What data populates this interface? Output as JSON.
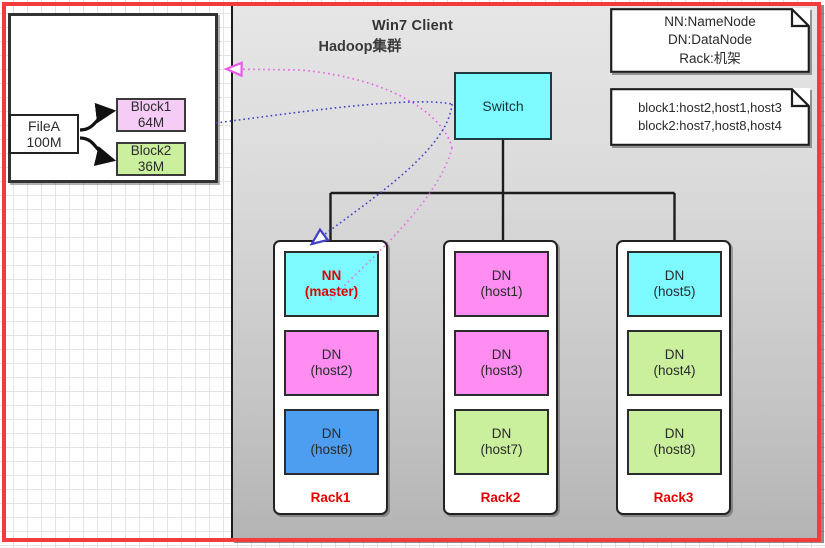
{
  "frame": {
    "border_color": "#f23b3b"
  },
  "client": {
    "title": "Win7 Client",
    "file": {
      "name": "FileA",
      "size": "100M"
    },
    "blocks": [
      {
        "name": "Block1",
        "size": "64M",
        "color": "#f5ccf5"
      },
      {
        "name": "Block2",
        "size": "36M",
        "color": "#caef9d"
      }
    ]
  },
  "hadoop": {
    "title": "Hadoop集群",
    "switch_label": "Switch",
    "switch_color": "#7dfaff",
    "racks": [
      {
        "label": "Rack1",
        "hosts": [
          {
            "role": "NN",
            "host": "(master)",
            "color": "#7dfaff",
            "master": true
          },
          {
            "role": "DN",
            "host": "(host2)",
            "color": "#ff8cf0",
            "master": false
          },
          {
            "role": "DN",
            "host": "(host6)",
            "color": "#4d9ef0",
            "master": false
          }
        ]
      },
      {
        "label": "Rack2",
        "hosts": [
          {
            "role": "DN",
            "host": "(host1)",
            "color": "#ff8cf0",
            "master": false
          },
          {
            "role": "DN",
            "host": "(host3)",
            "color": "#ff8cf0",
            "master": false
          },
          {
            "role": "DN",
            "host": "(host7)",
            "color": "#caef9d",
            "master": false
          }
        ]
      },
      {
        "label": "Rack3",
        "hosts": [
          {
            "role": "DN",
            "host": "(host5)",
            "color": "#7dfaff",
            "master": false
          },
          {
            "role": "DN",
            "host": "(host4)",
            "color": "#caef9d",
            "master": false
          },
          {
            "role": "DN",
            "host": "(host8)",
            "color": "#caef9d",
            "master": false
          }
        ]
      }
    ]
  },
  "notes": {
    "legend": {
      "lines": [
        "NN:NameNode",
        "DN:DataNode",
        "Rack:机架"
      ]
    },
    "placement": {
      "lines": [
        "block1:host2,host1,host3",
        "block2:host7,host8,host4"
      ]
    }
  },
  "flows": {
    "request_color": "#e85ce8",
    "response_color": "#4040c8"
  }
}
